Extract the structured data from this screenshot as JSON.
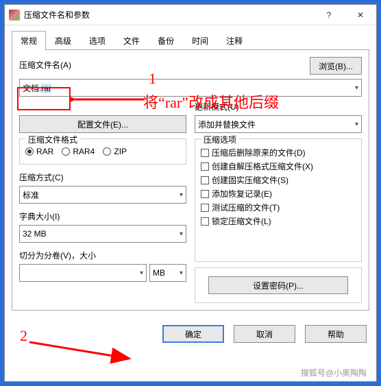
{
  "title": "压缩文件名和参数",
  "help": "?",
  "close": "✕",
  "tabs": [
    "常规",
    "高级",
    "选项",
    "文件",
    "备份",
    "时间",
    "注释"
  ],
  "archive_name_label": "压缩文件名(A)",
  "archive_name_value_prefix": "文档.",
  "archive_name_value_sel": "rar",
  "browse": "浏览(B)...",
  "profiles": "配置文件(E)...",
  "update_label": "更新模式(U)",
  "update_value": "添加并替换文件",
  "format_title": "压缩文件格式",
  "formats": [
    "RAR",
    "RAR4",
    "ZIP"
  ],
  "options_title": "压缩选项",
  "options": [
    "压缩后删除原来的文件(D)",
    "创建自解压格式压缩文件(X)",
    "创建固实压缩文件(S)",
    "添加恢复记录(E)",
    "测试压缩的文件(T)",
    "锁定压缩文件(L)"
  ],
  "method_label": "压缩方式(C)",
  "method_value": "标准",
  "dict_label": "字典大小(I)",
  "dict_value": "32 MB",
  "split_label": "切分为分卷(V)，大小",
  "split_unit": "MB",
  "set_password": "设置密码(P)...",
  "ok": "确定",
  "cancel": "取消",
  "helpbtn": "帮助",
  "anno1_num": "1",
  "anno1_text": "将“rar”改成其他后缀",
  "anno2_num": "2",
  "watermark": "搜狐号@小奥陶陶"
}
